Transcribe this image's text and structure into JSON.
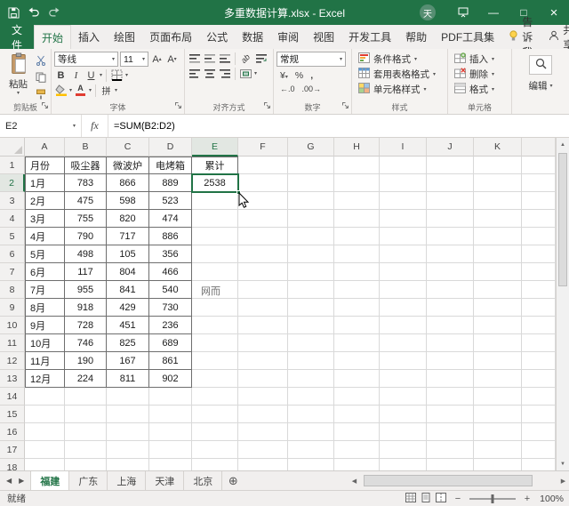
{
  "window": {
    "title": "多重数据计算.xlsx - Excel",
    "user_initial": "天"
  },
  "tabs": {
    "file": "文件",
    "items": [
      "开始",
      "插入",
      "绘图",
      "页面布局",
      "公式",
      "数据",
      "审阅",
      "视图",
      "开发工具",
      "帮助",
      "PDF工具集"
    ],
    "active": "开始",
    "tell_me": "告诉我",
    "share": "共享"
  },
  "ribbon": {
    "clipboard": {
      "label": "剪贴板",
      "paste": "粘贴"
    },
    "font": {
      "label": "字体",
      "name": "等线",
      "size": "11"
    },
    "alignment": {
      "label": "对齐方式"
    },
    "number": {
      "label": "数字",
      "format": "常规"
    },
    "styles": {
      "label": "样式",
      "items": [
        "条件格式",
        "套用表格格式",
        "单元格样式"
      ]
    },
    "cells": {
      "label": "单元格",
      "items": [
        "插入",
        "删除",
        "格式"
      ]
    },
    "editing": {
      "label": "编辑"
    }
  },
  "formula_bar": {
    "name_box": "E2",
    "fx": "fx",
    "formula": "=SUM(B2:D2)"
  },
  "grid": {
    "col_letters": [
      "A",
      "B",
      "C",
      "D",
      "E",
      "F",
      "G",
      "H",
      "I",
      "J",
      "K"
    ],
    "selected": {
      "col": "E",
      "row": 2
    },
    "watermark": "网而",
    "total_rows": 18,
    "rows": [
      [
        "月份",
        "吸尘器",
        "微波炉",
        "电烤箱",
        "累计"
      ],
      [
        "1月",
        "783",
        "866",
        "889",
        "2538"
      ],
      [
        "2月",
        "475",
        "598",
        "523",
        ""
      ],
      [
        "3月",
        "755",
        "820",
        "474",
        ""
      ],
      [
        "4月",
        "790",
        "717",
        "886",
        ""
      ],
      [
        "5月",
        "498",
        "105",
        "356",
        ""
      ],
      [
        "6月",
        "117",
        "804",
        "466",
        ""
      ],
      [
        "7月",
        "955",
        "841",
        "540",
        ""
      ],
      [
        "8月",
        "918",
        "429",
        "730",
        ""
      ],
      [
        "9月",
        "728",
        "451",
        "236",
        ""
      ],
      [
        "10月",
        "746",
        "825",
        "689",
        ""
      ],
      [
        "11月",
        "190",
        "167",
        "861",
        ""
      ],
      [
        "12月",
        "224",
        "811",
        "902",
        ""
      ]
    ]
  },
  "sheets": {
    "items": [
      "福建",
      "广东",
      "上海",
      "天津",
      "北京"
    ],
    "active": "福建"
  },
  "status_bar": {
    "ready": "就绪",
    "zoom": "100%"
  },
  "icons": {
    "caret": "▾",
    "bold": "B",
    "italic": "I",
    "underline": "U",
    "font_color_letter": "A",
    "grow_font": "A",
    "shrink_font": "A",
    "up": "▴",
    "down": "▾",
    "phonetic": "拼",
    "currency": "¥",
    "percent": "%",
    "comma": ",",
    "inc_decimal": "←.0",
    "dec_decimal": ".00→",
    "orientation": "ab",
    "minimize": "—",
    "maximize": "□",
    "close": "×",
    "nav_left": "◀",
    "nav_right": "▶",
    "add_sheet": "⊕",
    "scroll_up": "▲",
    "scroll_down": "▼",
    "zoom_out": "−",
    "zoom_in": "+"
  },
  "colors": {
    "accent_green": "#217346"
  }
}
